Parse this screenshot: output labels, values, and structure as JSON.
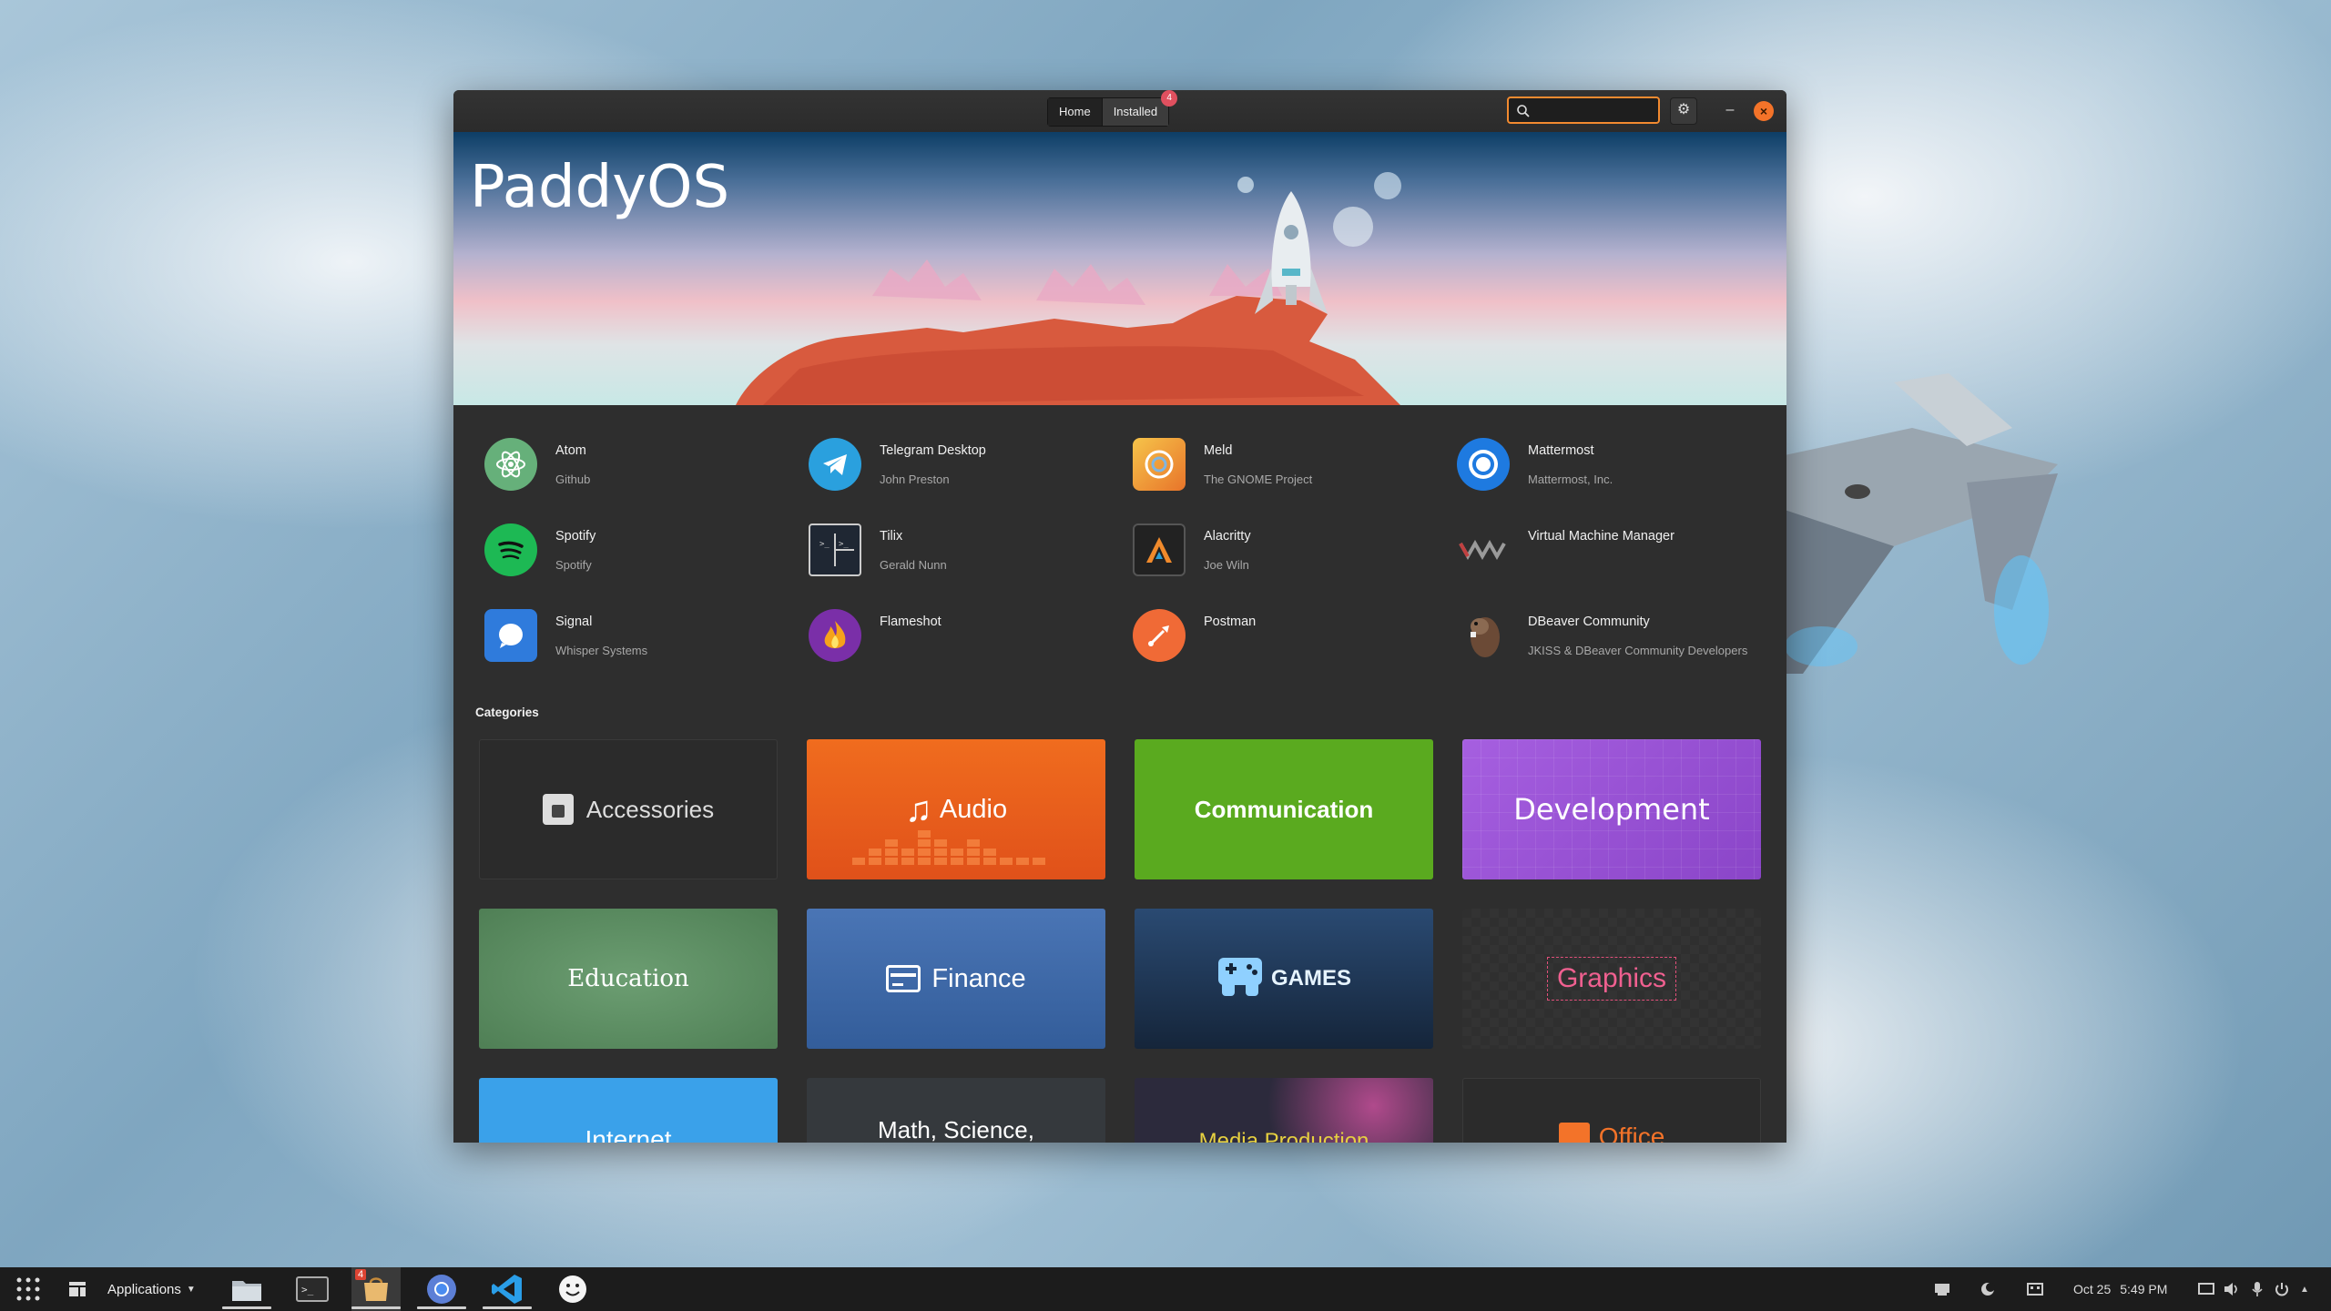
{
  "window": {
    "tabs": [
      {
        "label": "Home"
      },
      {
        "label": "Installed",
        "badge": "4"
      }
    ],
    "search": {
      "value": "",
      "placeholder": ""
    },
    "icons": {
      "gear": "gear-icon",
      "minimize": "minimize-icon",
      "close": "close-icon",
      "search": "search-icon"
    }
  },
  "banner": {
    "title": "PaddyOS"
  },
  "apps": [
    {
      "name": "Atom",
      "developer": "Github",
      "icon": "atom-icon",
      "color": "#66b07a"
    },
    {
      "name": "Telegram Desktop",
      "developer": "John Preston",
      "icon": "telegram-icon",
      "color": "#2aa0de"
    },
    {
      "name": "Meld",
      "developer": "The GNOME Project",
      "icon": "meld-icon",
      "color": "#f0a040"
    },
    {
      "name": "Mattermost",
      "developer": "Mattermost, Inc.",
      "icon": "mattermost-icon",
      "color": "#1e7ae0"
    },
    {
      "name": "Spotify",
      "developer": "Spotify",
      "icon": "spotify-icon",
      "color": "#1db954"
    },
    {
      "name": "Tilix",
      "developer": "Gerald Nunn",
      "icon": "tilix-icon",
      "color": "#2c3e55"
    },
    {
      "name": "Alacritty",
      "developer": "Joe Wiln",
      "icon": "alacritty-icon",
      "color": "#222"
    },
    {
      "name": "Virtual Machine Manager",
      "developer": "",
      "icon": "vmm-icon",
      "color": "#555"
    },
    {
      "name": "Signal",
      "developer": "Whisper Systems",
      "icon": "signal-icon",
      "color": "#2f7bdc"
    },
    {
      "name": "Flameshot",
      "developer": "",
      "icon": "flameshot-icon",
      "color": "#7a2fa8"
    },
    {
      "name": "Postman",
      "developer": "",
      "icon": "postman-icon",
      "color": "#f06a36"
    },
    {
      "name": "DBeaver Community",
      "developer": "JKISS & DBeaver Community Developers",
      "icon": "dbeaver-icon",
      "color": "#6b4a36"
    }
  ],
  "categories_label": "Categories",
  "categories": [
    {
      "label": "Accessories",
      "icon": "accessories-icon",
      "bg": "#2b2b2b"
    },
    {
      "label": "Audio",
      "icon": "music-note-icon",
      "bg": "#e9591b"
    },
    {
      "label": "Communication",
      "icon": "",
      "bg": "#5aaa1f"
    },
    {
      "label": "Development",
      "icon": "",
      "bg": "#9a55d6"
    },
    {
      "label": "Education",
      "icon": "",
      "bg": "#5b8f62"
    },
    {
      "label": "Finance",
      "icon": "finance-icon",
      "bg": "#3f6aa8"
    },
    {
      "label": "GAMES",
      "icon": "gamepad-icon",
      "bg": "#1e3450"
    },
    {
      "label": "Graphics",
      "icon": "",
      "bg": "#2f2f2f"
    },
    {
      "label": "Internet",
      "icon": "",
      "bg": "#3aa1ea"
    },
    {
      "label": "Math, Science,",
      "icon": "",
      "bg": "#35393d"
    },
    {
      "label": "Media Production",
      "icon": "",
      "bg": "#2c2a3c"
    },
    {
      "label": "Office",
      "icon": "office-icon",
      "bg": "#2b2b2b"
    }
  ],
  "taskbar": {
    "applications_label": "Applications",
    "files_badge": "4",
    "date": "Oct 25",
    "time": "5:49 PM"
  }
}
